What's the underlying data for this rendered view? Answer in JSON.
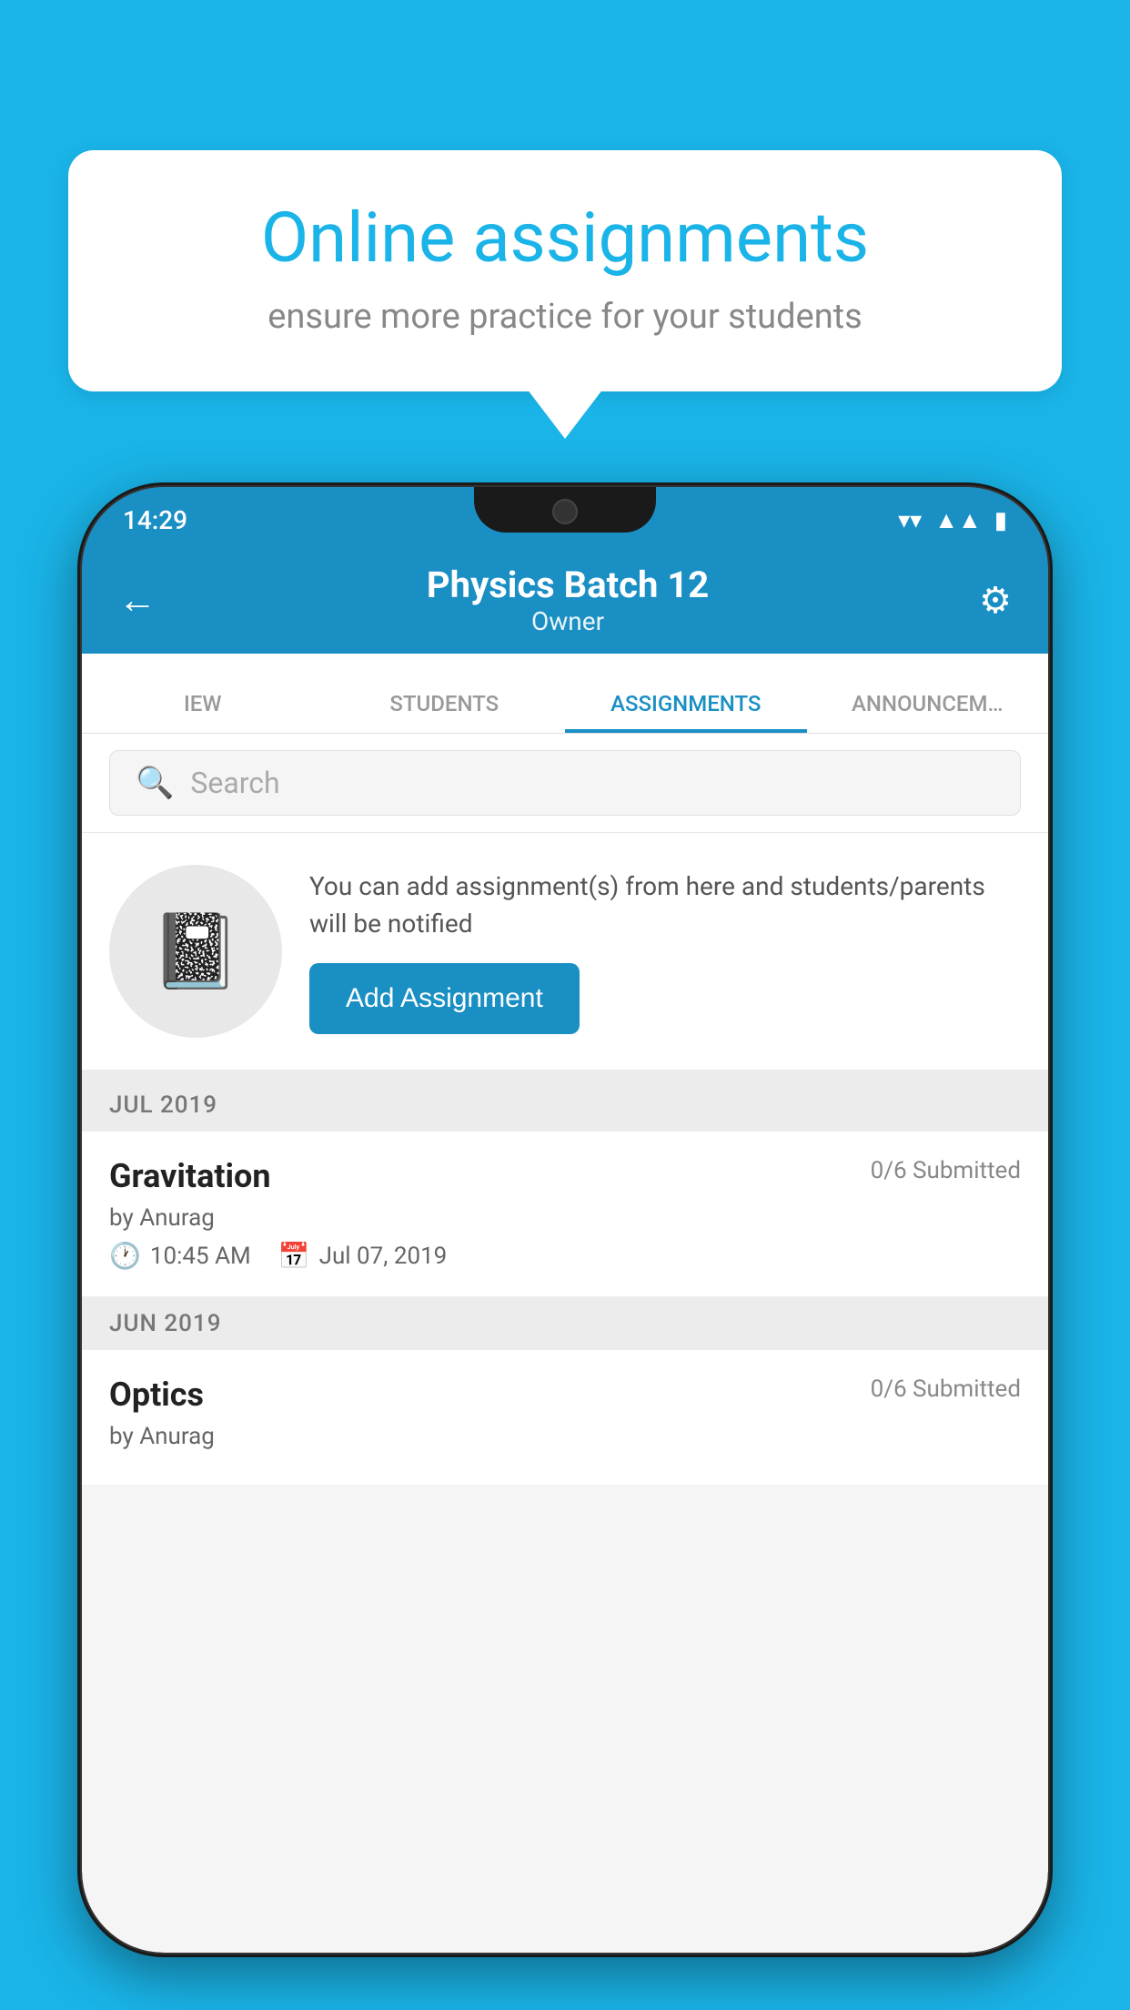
{
  "background_color": "#1ab4e8",
  "speech_bubble": {
    "title": "Online assignments",
    "subtitle": "ensure more practice for your students"
  },
  "phone": {
    "status_bar": {
      "time": "14:29"
    },
    "app_bar": {
      "title": "Physics Batch 12",
      "subtitle": "Owner",
      "back_label": "←",
      "settings_label": "⚙"
    },
    "tabs": [
      {
        "label": "IEW",
        "active": false
      },
      {
        "label": "STUDENTS",
        "active": false
      },
      {
        "label": "ASSIGNMENTS",
        "active": true
      },
      {
        "label": "ANNOUNCEM…",
        "active": false
      }
    ],
    "search": {
      "placeholder": "Search"
    },
    "promo": {
      "text": "You can add assignment(s) from here and students/parents will be notified",
      "button_label": "Add Assignment"
    },
    "sections": [
      {
        "month": "JUL 2019",
        "assignments": [
          {
            "title": "Gravitation",
            "submitted": "0/6 Submitted",
            "author": "by Anurag",
            "time": "10:45 AM",
            "date": "Jul 07, 2019"
          }
        ]
      },
      {
        "month": "JUN 2019",
        "assignments": [
          {
            "title": "Optics",
            "submitted": "0/6 Submitted",
            "author": "by Anurag",
            "time": "",
            "date": ""
          }
        ]
      }
    ]
  }
}
